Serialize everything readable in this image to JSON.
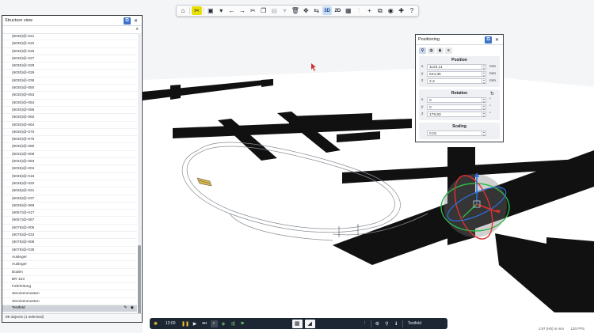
{
  "toolbar": {
    "buttons": [
      "home",
      "tools",
      "save",
      "undo",
      "redo",
      "cut",
      "copy",
      "paste",
      "delete",
      "move",
      "view-3d",
      "view-2d",
      "grid",
      "snap",
      "add",
      "duplicate",
      "camera",
      "plugins",
      "help"
    ],
    "view_3d_label": "3D",
    "view_2d_label": "2D"
  },
  "structure_view": {
    "title": "Structure view",
    "items": [
      "(6030)@-021",
      "(6030)@-022",
      "(6030)@-026",
      "(6030)@-027",
      "(6030)@-028",
      "(6030)@-029",
      "(6030)@-036",
      "(6030)@-050",
      "(6030)@-053",
      "(6030)@-054",
      "(6030)@-058",
      "(6030)@-060",
      "(6030)@-064",
      "(6030)@-070",
      "(6030)@-075",
      "(6030)@-080",
      "(6032)@-008",
      "(6032)@-063",
      "(6036)@-004",
      "(6036)@-016",
      "(6036)@-020",
      "(6036)@-021",
      "(6036)@-037",
      "(6036)@-068",
      "(6057)@-017",
      "(6057)@-067",
      "(6078)@-005",
      "(6078)@-033",
      "(6078)@-006",
      "(6078)@-035",
      "Ausleger",
      "Ausleger",
      "Boden",
      "BR 103",
      "Fahrleitung",
      "Streckenmasten",
      "Streckenmasten"
    ],
    "selected_item": "Testfeld",
    "status": "89 objects (1 selected)"
  },
  "positioning": {
    "title": "Positioning",
    "position_label": "Position",
    "rotation_label": "Rotation",
    "scaling_label": "Scaling",
    "position": [
      {
        "axis": "x",
        "value": "1123,11",
        "unit": "mm"
      },
      {
        "axis": "y",
        "value": "644,36",
        "unit": "mm"
      },
      {
        "axis": "z",
        "value": "2,3",
        "unit": "mm"
      }
    ],
    "rotation": [
      {
        "axis": "x",
        "value": "0",
        "unit": "°"
      },
      {
        "axis": "y",
        "value": "0",
        "unit": "°"
      },
      {
        "axis": "z",
        "value": "179,83",
        "unit": "°"
      }
    ],
    "scaling": "0,01"
  },
  "bottom_bar": {
    "time": "12:00",
    "object_name": "Testfeld"
  },
  "viewport": {
    "info": "1:87 (H0) in mm",
    "fps": "120 FPS"
  },
  "colors": {
    "accent_yellow": "#e8e000",
    "panel_border": "#3a3f46",
    "bottom_bar": "#1d2633",
    "gizmo_red": "#e03030",
    "gizmo_green": "#2fb84a",
    "gizmo_blue": "#2d6fe0"
  }
}
